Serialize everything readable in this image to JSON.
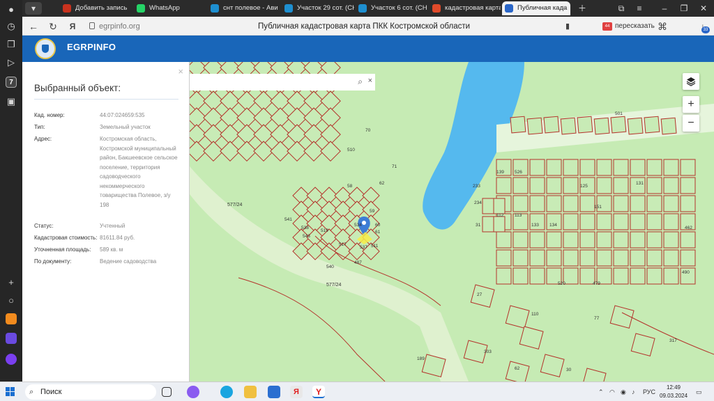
{
  "browser": {
    "tabs": [
      {
        "label": "Добавить запись",
        "color": "#c8321e"
      },
      {
        "label": "WhatsApp",
        "color": "#25d366"
      },
      {
        "label": "снт полевое - Ави",
        "color": "#1e8fd0"
      },
      {
        "label": "Участок 29 сот. (СН",
        "color": "#1e8fd0"
      },
      {
        "label": "Участок 6 сот. (СН",
        "color": "#1e8fd0"
      },
      {
        "label": "кадастровая карта",
        "color": "#e04a2a"
      },
      {
        "label": "Публичная када",
        "color": "#2a66c8",
        "active": true
      }
    ],
    "left_badge": "7",
    "url": "egrpinfo.org",
    "page_title": "Публичная кадастровая карта ПКК Костромской области",
    "retell_label": "пересказать",
    "notif_count": "33"
  },
  "site": {
    "brand": "EGRPINFO",
    "accent": "#1966b9"
  },
  "panel": {
    "title": "Выбранный объект:",
    "close_icon": "×",
    "rows": [
      {
        "label": "Кад. номер:",
        "value": "44:07:024659:535"
      },
      {
        "label": "Тип:",
        "value": "Земельный участок"
      },
      {
        "label": "Адрес:",
        "value": "Костромская область, Костромской муниципальный район, Бакшеевское сельское поселение, территория садоводческого некоммерческого товарищества Полевое, з/у 198"
      },
      {
        "label": "Статус:",
        "value": "Учтенный"
      },
      {
        "label": "Кадастровая стоимость:",
        "value": "81611.84 руб."
      },
      {
        "label": "Уточненная площадь:",
        "value": "589 кв. м"
      },
      {
        "label": "По документу:",
        "value": "Ведение садоводства"
      }
    ]
  },
  "map": {
    "search_icon": "⌕",
    "search_clear": "×",
    "zoom_in": "+",
    "zoom_out": "−",
    "layers_icon": "layers-icon",
    "road_label_1": "577/24",
    "road_label_2": "577/24",
    "parcel_color": "#b4332b",
    "water_color": "#55b9ee",
    "labels": [
      {
        "t": "534"
      },
      {
        "t": "60"
      },
      {
        "t": "61"
      },
      {
        "t": "511"
      },
      {
        "t": "537"
      },
      {
        "t": "517"
      },
      {
        "t": "519"
      },
      {
        "t": "538"
      },
      {
        "t": "541"
      },
      {
        "t": "543"
      },
      {
        "t": "540"
      },
      {
        "t": "487"
      },
      {
        "t": "59"
      },
      {
        "t": "58"
      },
      {
        "t": "62"
      },
      {
        "t": "71"
      },
      {
        "t": "70"
      },
      {
        "t": "510"
      },
      {
        "t": "233"
      },
      {
        "t": "234"
      },
      {
        "t": "31"
      },
      {
        "t": "112"
      },
      {
        "t": "113"
      },
      {
        "t": "133"
      },
      {
        "t": "134"
      },
      {
        "t": "125"
      },
      {
        "t": "131"
      },
      {
        "t": "27"
      },
      {
        "t": "110"
      },
      {
        "t": "77"
      },
      {
        "t": "317"
      },
      {
        "t": "189"
      },
      {
        "t": "303"
      },
      {
        "t": "62"
      },
      {
        "t": "30"
      },
      {
        "t": "490"
      },
      {
        "t": "462"
      },
      {
        "t": "501"
      },
      {
        "t": "139"
      },
      {
        "t": "526"
      },
      {
        "t": "151"
      },
      {
        "t": "520"
      },
      {
        "t": "479"
      }
    ]
  },
  "taskbar": {
    "search_label": "Поиск",
    "lang": "РУС",
    "time": "12:49",
    "date": "09.03.2024"
  }
}
